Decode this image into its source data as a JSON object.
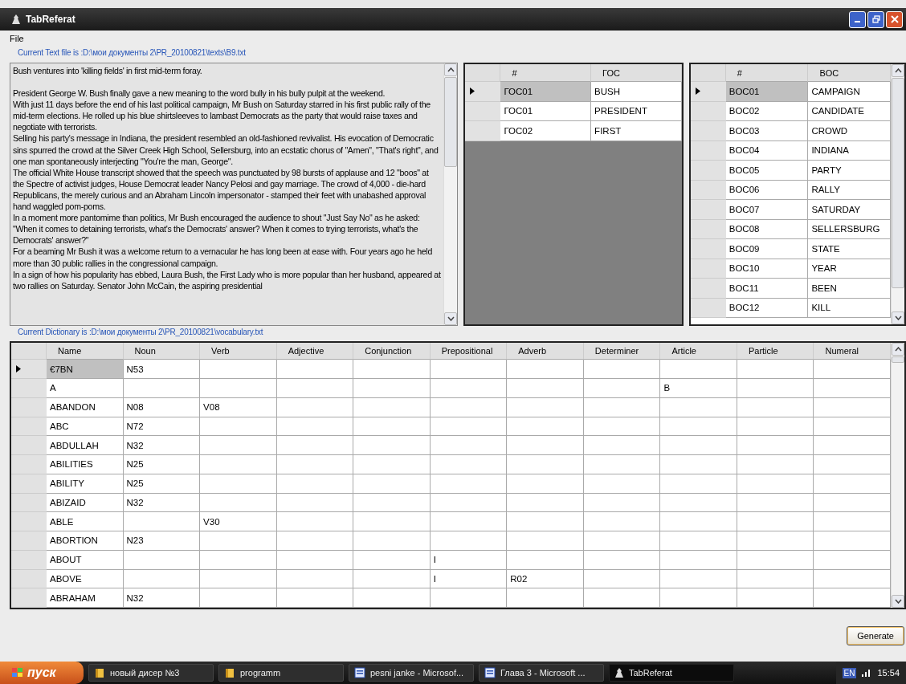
{
  "window": {
    "title": "TabReferat"
  },
  "menu": [
    "File"
  ],
  "text_file_label": "Current Text file is :D:\\мои документы 2\\PR_20100821\\texts\\B9.txt",
  "text_paragraphs": [
    "Bush ventures into 'killing fields' in first mid-term foray.",
    "President George W. Bush finally gave a new meaning to the word bully in his bully pulpit at the weekend.",
    "With just 11 days before the end of his last political campaign, Mr Bush on Saturday starred in his first public rally of the mid-term elections. He rolled up his blue shirtsleeves to lambast Democrats as the party that would raise taxes and negotiate with terrorists.",
    "Selling his party's message in Indiana, the president resembled an old-fashioned revivalist. His evocation of Democratic sins spurred the crowd at the Silver Creek High School, Sellersburg, into an ecstatic chorus of \"Amen\", \"That's right\", and one man spontaneously interjecting \"You're the man, George\".",
    "The official White House transcript showed that the speech was punctuated by 98 bursts of applause and 12 \"boos\" at the Spectre of activist judges, House Democrat leader Nancy Pelosi and gay marriage. The crowd of 4,000 - die-hard Republicans, the merely curious and an Abraham Lincoln impersonator - stamped their feet with unabashed approval hand waggled pom-poms.",
    "In a moment more pantomime than politics, Mr Bush encouraged the audience to shout \"Just Say No\" as he asked: \"When it comes to detaining terrorists, what's the Democrats' answer? When it comes to trying terrorists, what's the Democrats' answer?\"",
    "For a beaming Mr Bush it was a welcome return to a vernacular he has long been at ease with. Four years ago he held more than 30 public rallies in the congressional campaign.",
    "In a sign of how his popularity has ebbed, Laura Bush, the First Lady who is more popular than her husband, appeared at two rallies on Saturday. Senator John McCain, the aspiring presidential"
  ],
  "goc_table": {
    "columns": [
      "#",
      "ГОС"
    ],
    "rows": [
      {
        "selected": true,
        "cells": [
          "ГОС01",
          "BUSH"
        ]
      },
      {
        "selected": false,
        "cells": [
          "ГОС01",
          "PRESIDENT"
        ]
      },
      {
        "selected": false,
        "cells": [
          "ГОС02",
          "FIRST"
        ]
      }
    ]
  },
  "boc_table": {
    "columns": [
      "#",
      "BOC"
    ],
    "rows": [
      {
        "selected": true,
        "cells": [
          "BOC01",
          "CAMPAIGN"
        ]
      },
      {
        "selected": false,
        "cells": [
          "BOC02",
          "CANDIDATE"
        ]
      },
      {
        "selected": false,
        "cells": [
          "BOC03",
          "CROWD"
        ]
      },
      {
        "selected": false,
        "cells": [
          "BOC04",
          "INDIANA"
        ]
      },
      {
        "selected": false,
        "cells": [
          "BOC05",
          "PARTY"
        ]
      },
      {
        "selected": false,
        "cells": [
          "BOC06",
          "RALLY"
        ]
      },
      {
        "selected": false,
        "cells": [
          "BOC07",
          "SATURDAY"
        ]
      },
      {
        "selected": false,
        "cells": [
          "BOC08",
          "SELLERSBURG"
        ]
      },
      {
        "selected": false,
        "cells": [
          "BOC09",
          "STATE"
        ]
      },
      {
        "selected": false,
        "cells": [
          "BOC10",
          "YEAR"
        ]
      },
      {
        "selected": false,
        "cells": [
          "BOC11",
          "BEEN"
        ]
      },
      {
        "selected": false,
        "cells": [
          "BOC12",
          "KILL"
        ]
      }
    ]
  },
  "dictionary_label": "Current Dictionary is :D:\\мои документы 2\\PR_20100821\\vocabulary.txt",
  "dictionary_table": {
    "columns": [
      "Name",
      "Noun",
      "Verb",
      "Adjective",
      "Conjunction",
      "Prepositional",
      "Adverb",
      "Determiner",
      "Article",
      "Particle",
      "Numeral"
    ],
    "rows": [
      {
        "selected": true,
        "cells": [
          "€7BN",
          "N53",
          "",
          "",
          "",
          "",
          "",
          "",
          "",
          "",
          ""
        ]
      },
      {
        "selected": false,
        "cells": [
          "A",
          "",
          "",
          "",
          "",
          "",
          "",
          "",
          "B",
          "",
          ""
        ]
      },
      {
        "selected": false,
        "cells": [
          "ABANDON",
          "N08",
          "V08",
          "",
          "",
          "",
          "",
          "",
          "",
          "",
          ""
        ]
      },
      {
        "selected": false,
        "cells": [
          "ABC",
          "N72",
          "",
          "",
          "",
          "",
          "",
          "",
          "",
          "",
          ""
        ]
      },
      {
        "selected": false,
        "cells": [
          "ABDULLAH",
          "N32",
          "",
          "",
          "",
          "",
          "",
          "",
          "",
          "",
          ""
        ]
      },
      {
        "selected": false,
        "cells": [
          "ABILITIES",
          "N25",
          "",
          "",
          "",
          "",
          "",
          "",
          "",
          "",
          ""
        ]
      },
      {
        "selected": false,
        "cells": [
          "ABILITY",
          "N25",
          "",
          "",
          "",
          "",
          "",
          "",
          "",
          "",
          ""
        ]
      },
      {
        "selected": false,
        "cells": [
          "ABIZAID",
          "N32",
          "",
          "",
          "",
          "",
          "",
          "",
          "",
          "",
          ""
        ]
      },
      {
        "selected": false,
        "cells": [
          "ABLE",
          "",
          "V30",
          "",
          "",
          "",
          "",
          "",
          "",
          "",
          ""
        ]
      },
      {
        "selected": false,
        "cells": [
          "ABORTION",
          "N23",
          "",
          "",
          "",
          "",
          "",
          "",
          "",
          "",
          ""
        ]
      },
      {
        "selected": false,
        "cells": [
          "ABOUT",
          "",
          "",
          "",
          "",
          "I",
          "",
          "",
          "",
          "",
          ""
        ]
      },
      {
        "selected": false,
        "cells": [
          "ABOVE",
          "",
          "",
          "",
          "",
          "I",
          "R02",
          "",
          "",
          "",
          ""
        ]
      },
      {
        "selected": false,
        "cells": [
          "ABRAHAM",
          "N32",
          "",
          "",
          "",
          "",
          "",
          "",
          "",
          "",
          ""
        ]
      }
    ]
  },
  "generate_button": "Generate",
  "taskbar": {
    "start": "пуск",
    "items": [
      {
        "label": "новый дисер №3",
        "kind": "folder",
        "selected": false
      },
      {
        "label": "programm",
        "kind": "folder",
        "selected": false
      },
      {
        "label": "pesni janke - Microsof...",
        "kind": "document",
        "selected": false
      },
      {
        "label": "Глава 3 - Microsoft ...",
        "kind": "document",
        "selected": false
      },
      {
        "label": "TabReferat",
        "kind": "app",
        "selected": true
      }
    ],
    "language": "EN",
    "clock": "15:54"
  }
}
